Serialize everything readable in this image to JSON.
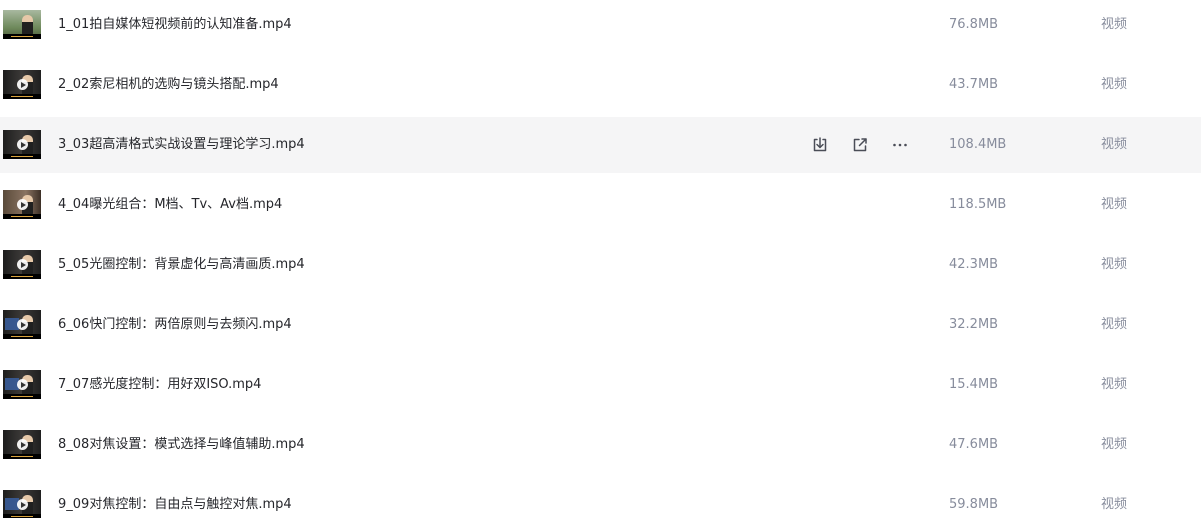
{
  "files": [
    {
      "name": "1_01拍自媒体短视频前的认知准备.mp4",
      "size": "76.8MB",
      "type": "视频",
      "thumbnail": "outdoor-speaker"
    },
    {
      "name": "2_02索尼相机的选购与镜头搭配.mp4",
      "size": "43.7MB",
      "type": "视频",
      "thumbnail": "studio-speaker"
    },
    {
      "name": "3_03超高清格式实战设置与理论学习.mp4",
      "size": "108.4MB",
      "type": "视频",
      "thumbnail": "studio-speaker"
    },
    {
      "name": "4_04曝光组合：M档、Tv、Av档.mp4",
      "size": "118.5MB",
      "type": "视频",
      "thumbnail": "warm-speaker"
    },
    {
      "name": "5_05光圈控制：背景虚化与高清画质.mp4",
      "size": "42.3MB",
      "type": "视频",
      "thumbnail": "studio-speaker"
    },
    {
      "name": "6_06快门控制：两倍原则与去频闪.mp4",
      "size": "32.2MB",
      "type": "视频",
      "thumbnail": "screen-speaker"
    },
    {
      "name": "7_07感光度控制：用好双ISO.mp4",
      "size": "15.4MB",
      "type": "视频",
      "thumbnail": "screen-speaker"
    },
    {
      "name": "8_08对焦设置：模式选择与峰值辅助.mp4",
      "size": "47.6MB",
      "type": "视频",
      "thumbnail": "studio-speaker"
    },
    {
      "name": "9_09对焦控制：自由点与触控对焦.mp4",
      "size": "59.8MB",
      "type": "视频",
      "thumbnail": "screen-speaker"
    }
  ],
  "hovered_row": 3,
  "row_actions": [
    "download-icon",
    "share-icon",
    "more-icon"
  ],
  "colors": {
    "hover_background": "#f5f5f6",
    "name_text": "#25262b",
    "meta_text": "#878c9c",
    "icon_stroke": "#4a4d57"
  }
}
